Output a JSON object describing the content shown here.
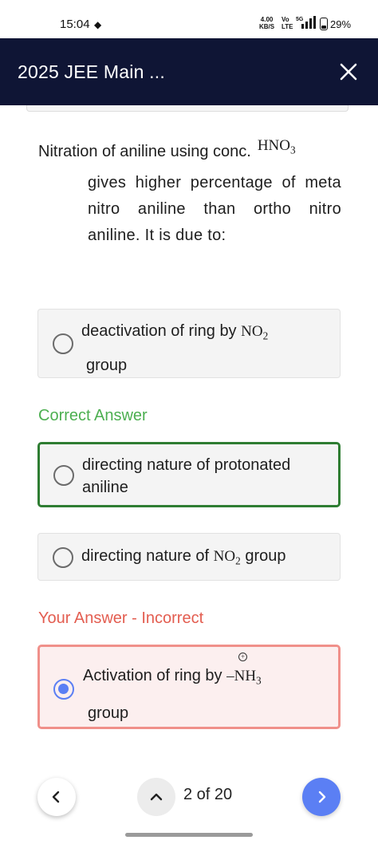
{
  "status_bar": {
    "time": "15:04",
    "speed_value": "4.00",
    "speed_unit": "KB/S",
    "volte_top": "Vo",
    "volte_bottom": "LTE",
    "network": "5G",
    "battery": "29%"
  },
  "header": {
    "title": "2025 JEE Main ...",
    "close_icon": "close-icon",
    "background": "#0f1535"
  },
  "question": {
    "text_line1": "Nitration of aniline using conc.",
    "formula_main": "HNO",
    "formula_sub": "3",
    "text_rest": "gives higher percentage of meta nitro aniline than ortho nitro aniline. It is due to:"
  },
  "options": [
    {
      "text_before": "deactivation of ring by",
      "formula_main": "NO",
      "formula_sub": "2",
      "text_after": "group",
      "selected": false
    },
    {
      "text": "directing nature of protonated aniline",
      "selected": false,
      "status": "correct"
    },
    {
      "text_before": "directing nature of",
      "formula_main": "NO",
      "formula_sub": "2",
      "text_after": "group",
      "selected": false
    },
    {
      "text_before": "Activation of ring by",
      "formula_main": "–NH",
      "formula_sub": "3",
      "formula_charge": "+",
      "text_after": "group",
      "selected": true,
      "status": "incorrect"
    }
  ],
  "labels": {
    "correct_answer": "Correct Answer",
    "your_answer": "Your Answer - Incorrect"
  },
  "navigation": {
    "prev_icon": "chevron-left-icon",
    "up_icon": "chevron-up-icon",
    "next_icon": "chevron-right-icon",
    "page_counter": "2 of 20"
  },
  "colors": {
    "correct": "#4caf50",
    "correct_border": "#2e7d32",
    "incorrect": "#e35d50",
    "incorrect_border": "#f0908a",
    "accent": "#5b7ff4"
  }
}
